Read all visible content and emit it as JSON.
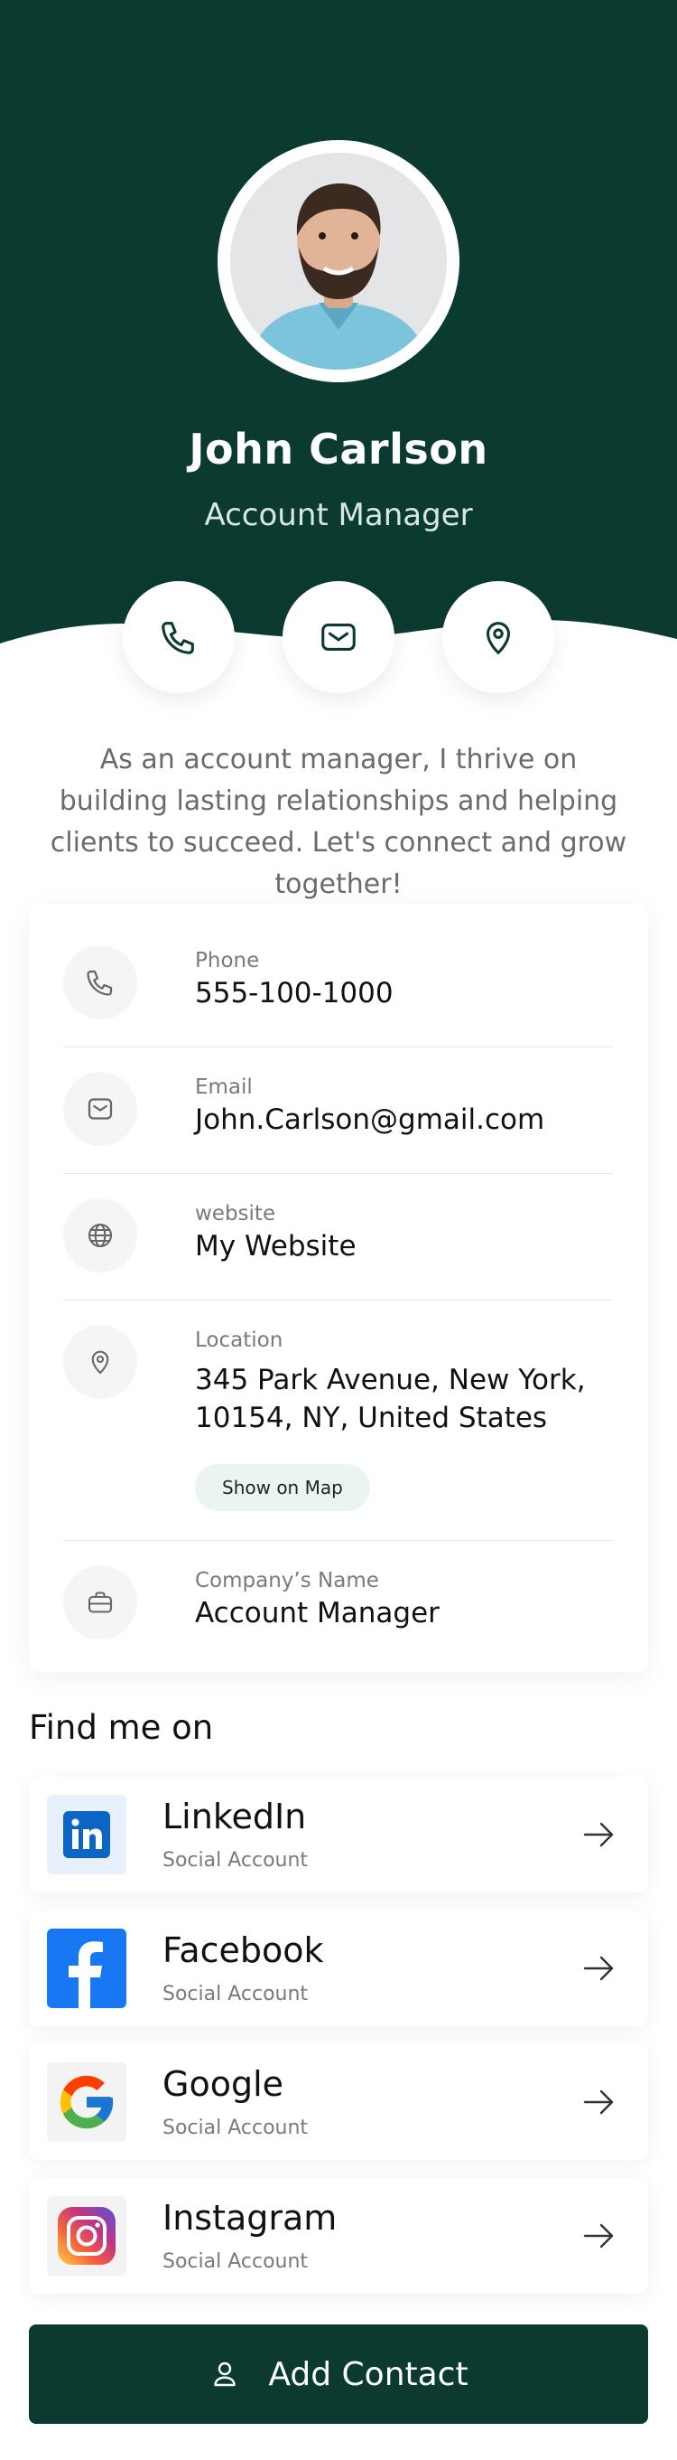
{
  "colors": {
    "brand": "#0b3b30",
    "pill": "#eaf5f1"
  },
  "profile": {
    "name": "John Carlson",
    "title": "Account Manager",
    "bio": "As an account manager, I thrive on building lasting relationships and helping clients to succeed. Let's connect and grow together!"
  },
  "actions": [
    {
      "icon": "phone-icon"
    },
    {
      "icon": "mail-icon"
    },
    {
      "icon": "location-pin-icon"
    }
  ],
  "contact": {
    "phone": {
      "label": "Phone",
      "value": "555-100-1000",
      "icon": "phone-icon"
    },
    "email": {
      "label": "Email",
      "value": "John.Carlson@gmail.com",
      "icon": "mail-icon"
    },
    "website": {
      "label": "website",
      "value": "My Website",
      "icon": "globe-icon"
    },
    "location": {
      "label": "Location",
      "value_line1": "345 Park Avenue, New York,",
      "value_line2": "10154, NY, United States",
      "map_button": "Show on Map",
      "icon": "location-pin-icon"
    },
    "company": {
      "label": "Company’s Name",
      "value": "Account Manager",
      "icon": "briefcase-icon"
    }
  },
  "social_section": {
    "heading": "Find me on",
    "items": [
      {
        "name": "LinkedIn",
        "sub": "Social Account",
        "icon": "linkedin-icon"
      },
      {
        "name": "Facebook",
        "sub": "Social Account",
        "icon": "facebook-icon"
      },
      {
        "name": "Google",
        "sub": "Social Account",
        "icon": "google-icon"
      },
      {
        "name": "Instagram",
        "sub": "Social Account",
        "icon": "instagram-icon"
      }
    ]
  },
  "add_contact": {
    "label": "Add Contact",
    "icon": "user-icon"
  }
}
